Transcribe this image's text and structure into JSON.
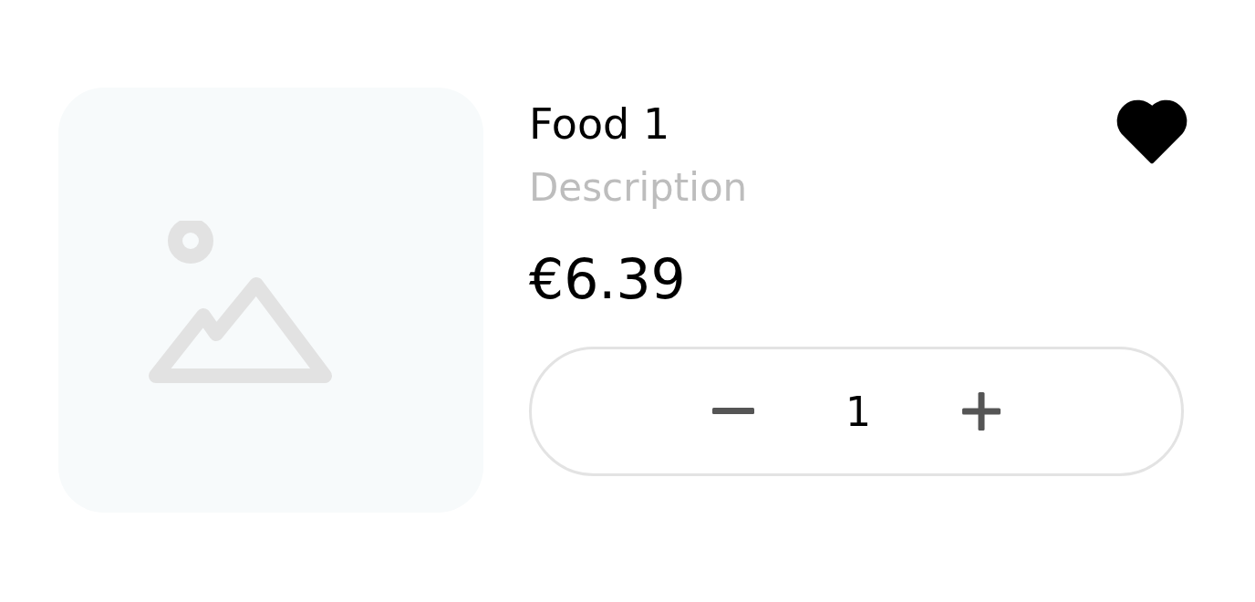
{
  "product": {
    "name": "Food 1",
    "description": "Description",
    "price": "€6.39",
    "favorite": true,
    "quantity": "1"
  }
}
